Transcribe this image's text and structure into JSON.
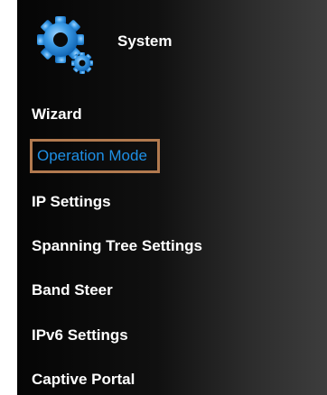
{
  "sidebar": {
    "header": {
      "icon": "gears-icon",
      "title": "System"
    },
    "items": [
      {
        "label": "Wizard",
        "active": false
      },
      {
        "label": "Operation Mode",
        "active": true
      },
      {
        "label": "IP Settings",
        "active": false
      },
      {
        "label": "Spanning Tree Settings",
        "active": false
      },
      {
        "label": "Band Steer",
        "active": false
      },
      {
        "label": "IPv6 Settings",
        "active": false
      },
      {
        "label": "Captive Portal",
        "active": false
      }
    ],
    "colors": {
      "text": "#ffffff",
      "active_text": "#1e90e6",
      "highlight_border": "#b27a4f",
      "icon": "#2b8fe0"
    }
  }
}
